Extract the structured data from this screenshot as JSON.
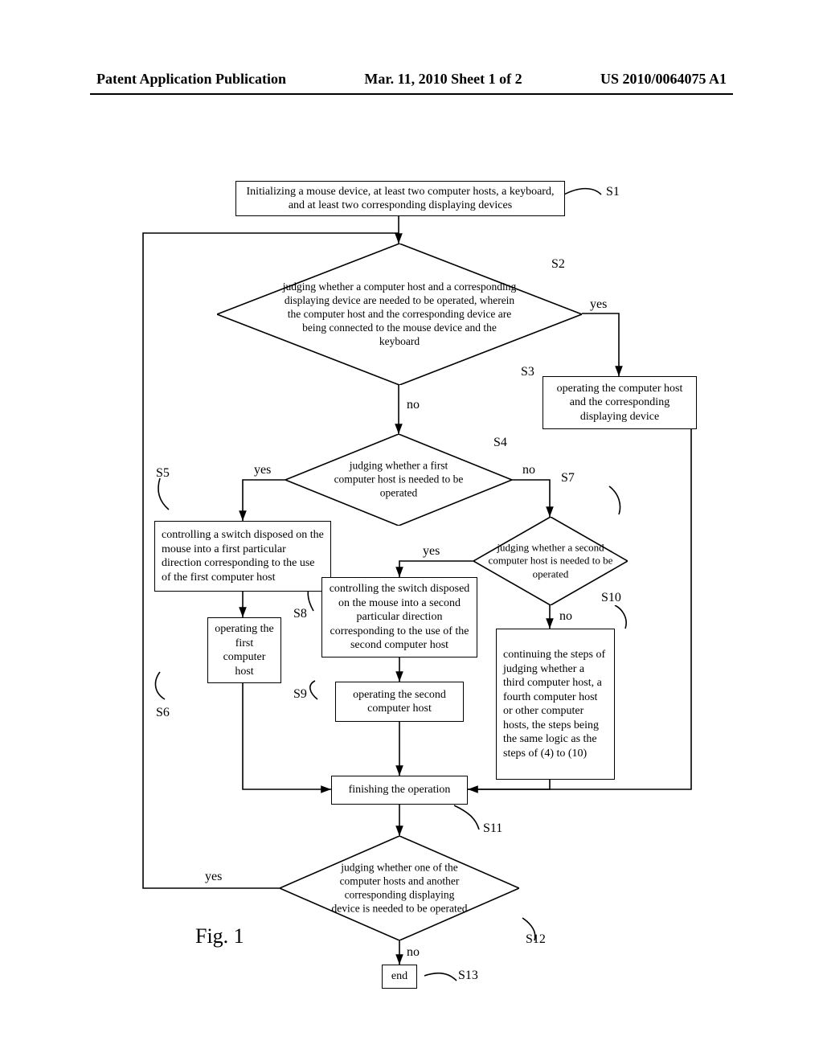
{
  "header": {
    "left": "Patent Application Publication",
    "center": "Mar. 11, 2010  Sheet 1 of 2",
    "right": "US 2010/0064075 A1"
  },
  "figure_label": "Fig.  1",
  "steps": {
    "S1": {
      "id": "S1",
      "text": "Initializing a mouse device, at least two computer hosts, a keyboard, and at least two corresponding displaying devices"
    },
    "S2": {
      "id": "S2",
      "text": "judging whether a computer host and a corresponding displaying device are needed to be operated, wherein the computer host and the corresponding device are being connected to the mouse device and the keyboard"
    },
    "S3": {
      "id": "S3",
      "text": "operating the computer host and the corresponding displaying device"
    },
    "S4": {
      "id": "S4",
      "text": "judging whether a first computer host is needed to be operated"
    },
    "S5": {
      "id": "S5",
      "text": "controlling a switch disposed on the mouse into a first particular direction corresponding to the use of the first computer host"
    },
    "S6": {
      "id": "S6",
      "text": "operating the first computer host"
    },
    "S7": {
      "id": "S7",
      "text": "judging whether a second computer host is needed to be operated"
    },
    "S8": {
      "id": "S8",
      "text": "controlling the switch disposed on the mouse into a second particular direction corresponding to the use of the second computer host"
    },
    "S9": {
      "id": "S9",
      "text": "operating the second computer host"
    },
    "S10": {
      "id": "S10",
      "text": "continuing the steps of judging whether a third computer host, a fourth computer host or other computer hosts, the steps being the same logic as the steps of (4) to (10)"
    },
    "S11": {
      "id": "S11",
      "text": "finishing the operation"
    },
    "S12": {
      "id": "S12",
      "text": "judging whether one of the computer hosts and another corresponding displaying device is needed to be operated"
    },
    "S13": {
      "id": "S13",
      "text": "end"
    }
  },
  "branches": {
    "yes": "yes",
    "no": "no"
  },
  "chart_data": {
    "type": "diagram",
    "title": "Fig. 1",
    "nodes": [
      {
        "id": "S1",
        "kind": "process",
        "text": "Initializing a mouse device, at least two computer hosts, a keyboard, and at least two corresponding displaying devices"
      },
      {
        "id": "S2",
        "kind": "decision",
        "text": "judging whether a computer host and a corresponding displaying device are needed to be operated, wherein the computer host and the corresponding device are being connected to the mouse device and the keyboard"
      },
      {
        "id": "S3",
        "kind": "process",
        "text": "operating the computer host and the corresponding displaying device"
      },
      {
        "id": "S4",
        "kind": "decision",
        "text": "judging whether a first computer host is needed to be operated"
      },
      {
        "id": "S5",
        "kind": "process",
        "text": "controlling a switch disposed on the mouse into a first particular direction corresponding to the use of the first computer host"
      },
      {
        "id": "S6",
        "kind": "process",
        "text": "operating the first computer host"
      },
      {
        "id": "S7",
        "kind": "decision",
        "text": "judging whether a second computer host is needed to be operated"
      },
      {
        "id": "S8",
        "kind": "process",
        "text": "controlling the switch disposed on the mouse into a second particular direction corresponding to the use of the second computer host"
      },
      {
        "id": "S9",
        "kind": "process",
        "text": "operating the second computer host"
      },
      {
        "id": "S10",
        "kind": "process",
        "text": "continuing the steps of judging whether a third computer host, a fourth computer host or other computer hosts, the steps being the same logic as the steps of (4) to (10)"
      },
      {
        "id": "S11",
        "kind": "process",
        "text": "finishing the operation"
      },
      {
        "id": "S12",
        "kind": "decision",
        "text": "judging whether one of the computer hosts and another corresponding displaying device is needed to be operated"
      },
      {
        "id": "S13",
        "kind": "terminator",
        "text": "end"
      }
    ],
    "edges": [
      {
        "from": "S1",
        "to": "S2",
        "label": ""
      },
      {
        "from": "S2",
        "to": "S3",
        "label": "yes"
      },
      {
        "from": "S2",
        "to": "S4",
        "label": "no"
      },
      {
        "from": "S3",
        "to": "S11",
        "label": ""
      },
      {
        "from": "S4",
        "to": "S5",
        "label": "yes"
      },
      {
        "from": "S4",
        "to": "S7",
        "label": "no"
      },
      {
        "from": "S5",
        "to": "S6",
        "label": ""
      },
      {
        "from": "S6",
        "to": "S11",
        "label": ""
      },
      {
        "from": "S7",
        "to": "S8",
        "label": "yes"
      },
      {
        "from": "S7",
        "to": "S10",
        "label": "no"
      },
      {
        "from": "S8",
        "to": "S9",
        "label": ""
      },
      {
        "from": "S9",
        "to": "S11",
        "label": ""
      },
      {
        "from": "S10",
        "to": "S11",
        "label": ""
      },
      {
        "from": "S11",
        "to": "S12",
        "label": ""
      },
      {
        "from": "S12",
        "to": "S2",
        "label": "yes"
      },
      {
        "from": "S12",
        "to": "S13",
        "label": "no"
      }
    ]
  }
}
